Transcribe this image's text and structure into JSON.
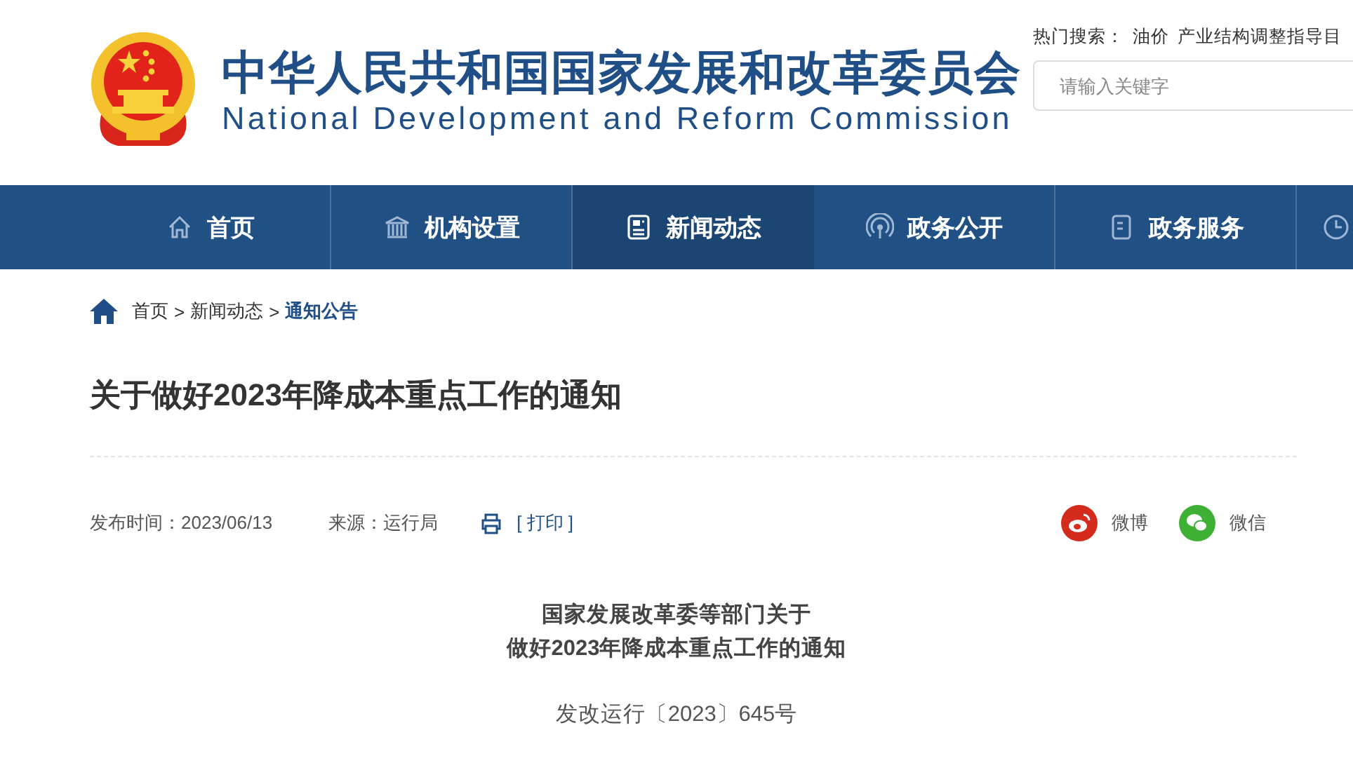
{
  "header": {
    "title_cn": "中华人民共和国国家发展和改革委员会",
    "title_en": "National Development and Reform Commission",
    "hot_search": {
      "label": "热门搜索：",
      "terms": [
        "油价",
        "产业结构调整指导目"
      ]
    },
    "search": {
      "placeholder": "请输入关键字"
    }
  },
  "nav": [
    {
      "label": "首页",
      "selected": false
    },
    {
      "label": "机构设置",
      "selected": false
    },
    {
      "label": "新闻动态",
      "selected": true
    },
    {
      "label": "政务公开",
      "selected": false
    },
    {
      "label": "政务服务",
      "selected": false
    }
  ],
  "breadcrumb": [
    {
      "label": "首页",
      "selected": false
    },
    {
      "separator": ">",
      "label": "新闻动态",
      "selected": false
    },
    {
      "separator": ">",
      "label": "通知公告",
      "selected": true
    }
  ],
  "article": {
    "title": "关于做好2023年降成本重点工作的通知",
    "published": "发布时间：2023/06/13",
    "source": "来源：运行局",
    "print": "[ 打印 ]",
    "share": [
      {
        "kind": "weibo",
        "label": "微博"
      },
      {
        "kind": "wechat",
        "label": "微信"
      }
    ],
    "heading_lines": [
      "国家发展改革委等部门关于",
      "做好2023年降成本重点工作的通知"
    ],
    "doc_number": "发改运行〔2023〕645号"
  }
}
